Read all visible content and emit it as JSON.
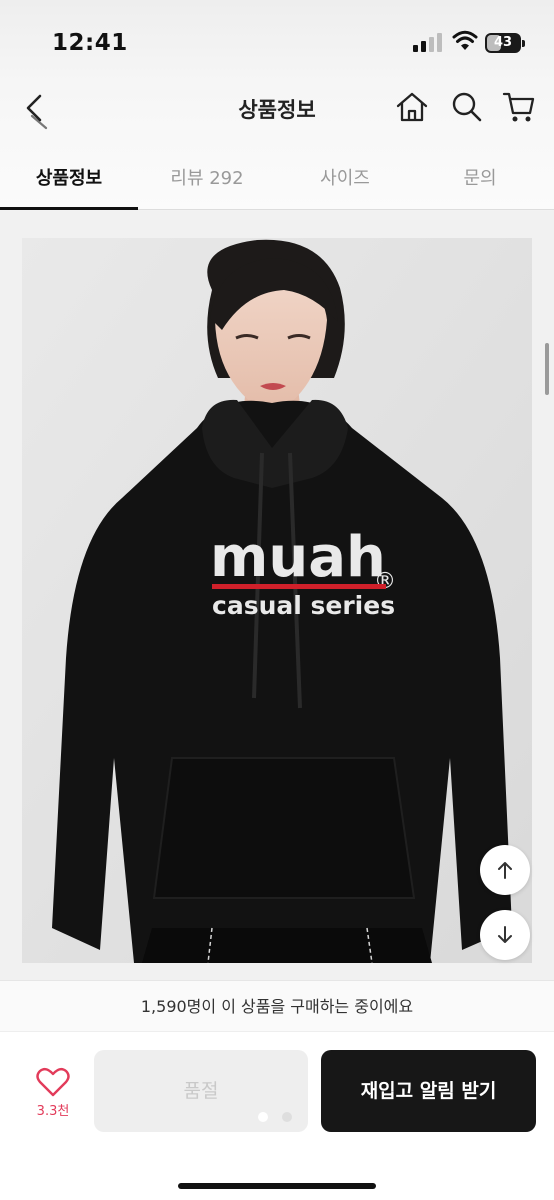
{
  "status_bar": {
    "time": "12:41",
    "battery": "43",
    "battery_level": 0.43
  },
  "nav": {
    "title": "상품정보",
    "back_icon": "back-arrow-icon",
    "icons": [
      "home-icon",
      "search-icon",
      "cart-icon"
    ]
  },
  "tabs": [
    {
      "label": "상품정보",
      "active": true
    },
    {
      "label": "리뷰 292",
      "active": false
    },
    {
      "label": "사이즈",
      "active": false
    },
    {
      "label": "문의",
      "active": false
    }
  ],
  "product_image": {
    "print_line1": "muah",
    "print_mark": "®",
    "print_line2": "casual series"
  },
  "scroll_buttons": [
    "arrow-up-icon",
    "arrow-down-icon"
  ],
  "footer": {
    "buyers_text": "1,590명이 이 상품을 구매하는 중이에요",
    "like_count": "3.3천",
    "soldout_label": "품절",
    "restock_label": "재입고 알림 받기",
    "page_dots": 2,
    "active_dot": 0
  },
  "colors": {
    "accent_red": "#e23b5a",
    "dark_button": "#171717",
    "print_red": "#d0202a"
  }
}
